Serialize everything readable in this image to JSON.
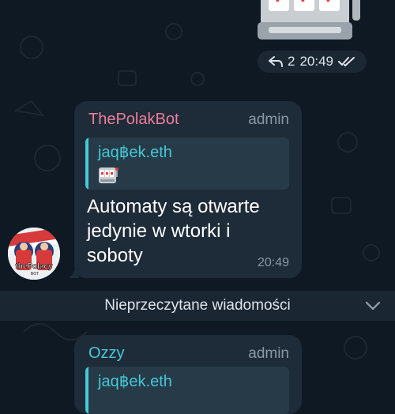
{
  "top_sticker": {
    "icon": "slot-machine-icon"
  },
  "message_meta": {
    "replies": "2",
    "time": "20:49",
    "reply_icon": "reply-arrow-icon",
    "status_icon": "double-check-icon"
  },
  "messages": [
    {
      "sender": "ThePolakBot",
      "role": "admin",
      "quote": {
        "author": "jaq฿ek.eth",
        "sticker": "slot-machine-icon"
      },
      "text": "Automaty są otwarte\njedynie w wtorki i\nsoboty",
      "time": "20:49",
      "avatar": {
        "caption": "thePolacy",
        "sub": "BOT"
      }
    },
    {
      "sender": "Ozzy",
      "role": "admin",
      "quote": {
        "author": "jaq฿ek.eth"
      }
    }
  ],
  "unread_divider": {
    "label": "Nieprzeczytane wiadomości",
    "icon": "chevron-down-icon"
  },
  "colors": {
    "background": "#0f1923",
    "bubble": "#1e2b38",
    "accent": "#46c8d8",
    "sender_pink": "#ec7e9a",
    "muted": "#8a98a6"
  }
}
